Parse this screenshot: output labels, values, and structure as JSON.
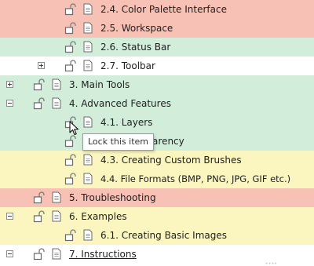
{
  "tree": {
    "rows": [
      {
        "label": "2.4. Color Palette Interface",
        "color": "red",
        "expander": "none"
      },
      {
        "label": "2.5. Workspace",
        "color": "red",
        "expander": "none"
      },
      {
        "label": "2.6. Status Bar",
        "color": "green",
        "expander": "none"
      },
      {
        "label": "2.7. Toolbar",
        "color": "white",
        "expander": "plus"
      },
      {
        "label": "3. Main Tools",
        "color": "green",
        "expander": "plus"
      },
      {
        "label": "4. Advanced Features",
        "color": "green",
        "expander": "minus"
      },
      {
        "label": "4.1. Layers",
        "color": "green",
        "expander": "none"
      },
      {
        "label": "4.2. Transparency",
        "color": "green",
        "expander": "none"
      },
      {
        "label": "4.3. Creating Custom Brushes",
        "color": "yellow",
        "expander": "none"
      },
      {
        "label": "4.4. File Formats (BMP, PNG, JPG, GIF etc.)",
        "color": "yellow",
        "expander": "none"
      },
      {
        "label": "5. Troubleshooting",
        "color": "red",
        "expander": "none"
      },
      {
        "label": "6. Examples",
        "color": "yellow",
        "expander": "minus"
      },
      {
        "label": "6.1. Creating Basic Images",
        "color": "yellow",
        "expander": "none"
      },
      {
        "label": "7. Instructions",
        "color": "white",
        "expander": "minus"
      }
    ],
    "icons": {
      "lock": "unlocked-padlock-icon",
      "document": "document-icon"
    }
  },
  "tooltip": {
    "text": "Lock this item"
  }
}
